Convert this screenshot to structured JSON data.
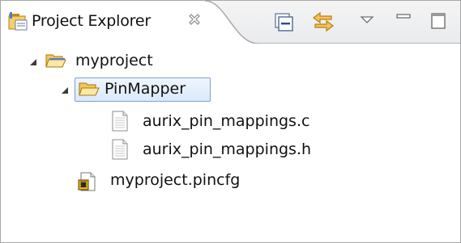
{
  "view": {
    "tab_title": "Project Explorer",
    "tab_icon": "project-explorer-icon",
    "close_icon": "close-icon",
    "toolbar": [
      {
        "name": "collapse-all-button",
        "icon": "collapse-all-icon"
      },
      {
        "name": "link-with-editor-button",
        "icon": "link-with-editor-icon"
      },
      {
        "name": "view-menu-button",
        "icon": "view-menu-icon"
      },
      {
        "name": "minimize-button",
        "icon": "minimize-icon"
      },
      {
        "name": "maximize-button",
        "icon": "maximize-icon"
      }
    ]
  },
  "tree": {
    "nodes": [
      {
        "label": "myproject",
        "icon": "open-project-folder-icon",
        "expanded": true
      },
      {
        "label": "PinMapper",
        "icon": "open-folder-icon",
        "expanded": true,
        "selected": true
      },
      {
        "label": "aurix_pin_mappings.c",
        "icon": "file-icon"
      },
      {
        "label": "aurix_pin_mappings.h",
        "icon": "file-icon"
      },
      {
        "label": "myproject.pincfg",
        "icon": "pin-config-icon"
      }
    ]
  },
  "colors": {
    "selection_border": "#7da2ce",
    "selection_fill": "#dbe9fa",
    "folder_fill": "#f4cf6b",
    "toolbar_accent": "#d79b1f"
  }
}
